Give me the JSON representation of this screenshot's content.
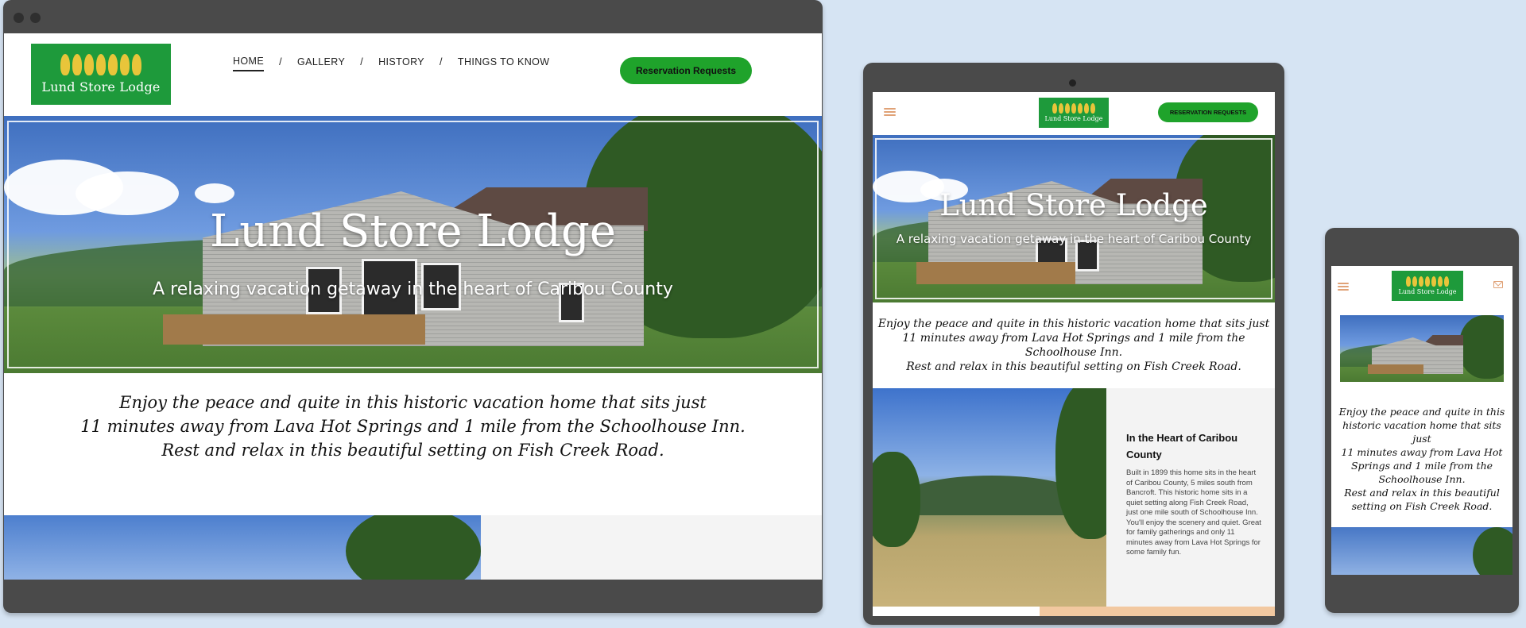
{
  "site": {
    "logo_text": "Lund Store Lodge",
    "hero_title": "Lund Store Lodge",
    "hero_subtitle": "A relaxing vacation getaway in the heart of Caribou County",
    "intro_line1": "Enjoy the peace and quite in this historic vacation home that sits just",
    "intro_line2": "11 minutes away from Lava Hot Springs and 1 mile from the Schoolhouse Inn.",
    "intro_line3": "Rest and relax in this beautiful setting on Fish Creek Road."
  },
  "nav": {
    "items": [
      {
        "label": "HOME",
        "active": true
      },
      {
        "label": "GALLERY"
      },
      {
        "label": "HISTORY"
      },
      {
        "label": "THINGS TO KNOW"
      }
    ],
    "separator": "/"
  },
  "buttons": {
    "reservation_desktop": "Reservation Requests",
    "reservation_tablet": "RESERVATION REQUESTS"
  },
  "tablet": {
    "section_title": "In the Heart of Caribou County",
    "section_body": "Built in 1899 this home sits in the heart of Caribou County, 5 miles south from Bancroft. This historic home sits in a quiet setting along Fish Creek Road, just one mile south of Schoolhouse Inn.  You'll enjoy the scenery and quiet. Great for family gatherings and only 11 minutes away from Lava Hot Springs for some family fun."
  },
  "colors": {
    "background": "#d6e4f3",
    "brand_green": "#1e9a3b",
    "button_green": "#1fa32b",
    "accent_orange": "#e0a277",
    "device_frame": "#4a4a4a"
  },
  "icons": {
    "menu": "hamburger-icon",
    "mail": "mail-icon",
    "logo": "wheat-logo"
  }
}
